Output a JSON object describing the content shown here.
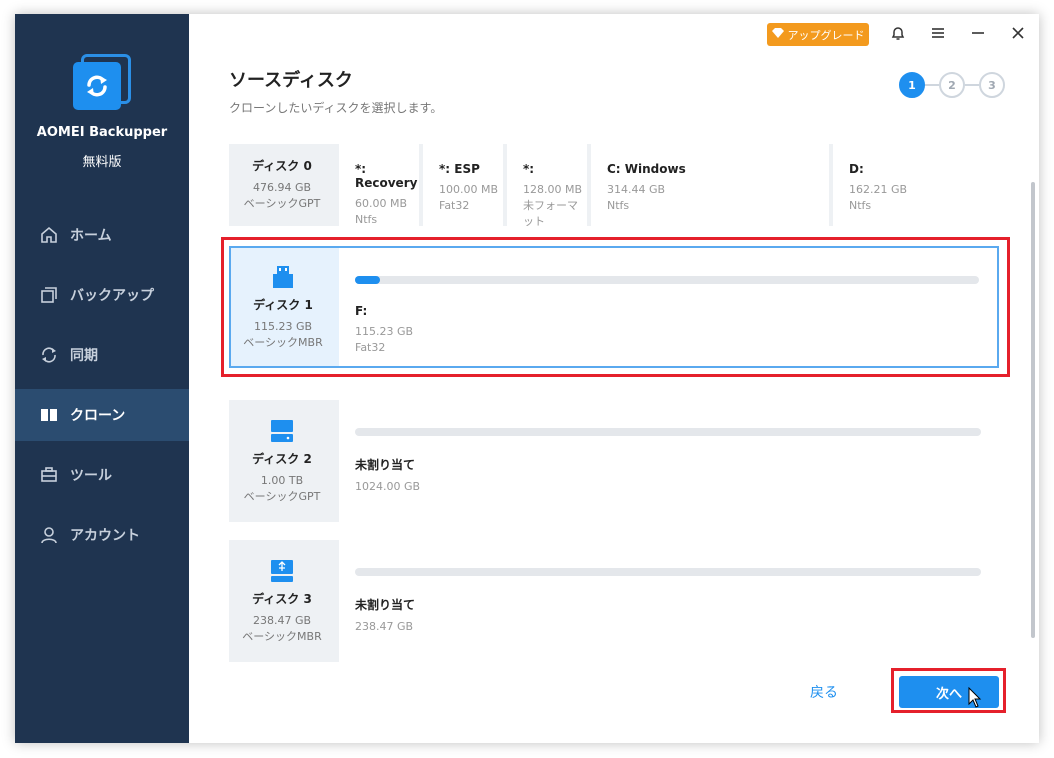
{
  "app": {
    "name": "AOMEI Backupper",
    "edition": "無料版"
  },
  "titlebar": {
    "upgrade_label": "アップグレード"
  },
  "sidebar": {
    "items": [
      {
        "label": "ホーム",
        "icon": "home-icon"
      },
      {
        "label": "バックアップ",
        "icon": "backup-icon"
      },
      {
        "label": "同期",
        "icon": "sync-icon"
      },
      {
        "label": "クローン",
        "icon": "clone-icon",
        "active": true
      },
      {
        "label": "ツール",
        "icon": "tools-icon"
      },
      {
        "label": "アカウント",
        "icon": "account-icon"
      }
    ]
  },
  "header": {
    "title": "ソースディスク",
    "subtitle": "クローンしたいディスクを選択します。",
    "steps": [
      "1",
      "2",
      "3"
    ],
    "active_step": 1
  },
  "disks": [
    {
      "name": "ディスク 0",
      "size": "476.94 GB",
      "style": "ベーシックGPT",
      "partitions": [
        {
          "label": "*: Recovery",
          "size": "60.00 MB",
          "fs": "Ntfs"
        },
        {
          "label": "*: ESP",
          "size": "100.00 MB",
          "fs": "Fat32"
        },
        {
          "label": "*:",
          "size": "128.00 MB",
          "fs": "未フォーマット"
        },
        {
          "label": "C: Windows",
          "size": "314.44 GB",
          "fs": "Ntfs"
        },
        {
          "label": "D:",
          "size": "162.21 GB",
          "fs": "Ntfs"
        }
      ]
    },
    {
      "name": "ディスク 1",
      "size": "115.23 GB",
      "style": "ベーシックMBR",
      "selected": true,
      "partitions": [
        {
          "label": "F:",
          "size": "115.23 GB",
          "fs": "Fat32",
          "used_fraction": 0.005
        }
      ]
    },
    {
      "name": "ディスク 2",
      "size": "1.00 TB",
      "style": "ベーシックGPT",
      "partitions": [
        {
          "label": "未割り当て",
          "size": "1024.00 GB",
          "fs": ""
        }
      ]
    },
    {
      "name": "ディスク 3",
      "size": "238.47 GB",
      "style": "ベーシックMBR",
      "partitions": [
        {
          "label": "未割り当て",
          "size": "238.47 GB",
          "fs": ""
        }
      ]
    }
  ],
  "footer": {
    "back_label": "戻る",
    "next_label": "次へ"
  },
  "colors": {
    "accent": "#1e8fef",
    "sidebar_bg": "#1f3450",
    "highlight": "#e5202b",
    "upgrade": "#f39a1e"
  }
}
